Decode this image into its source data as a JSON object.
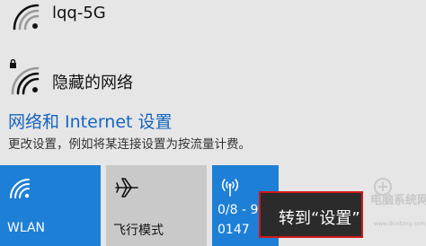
{
  "networks": [
    {
      "name": "lqq-5G",
      "icon": "wifi-icon"
    },
    {
      "name": "隐藏的网络",
      "icon": "wifi-lock-icon"
    }
  ],
  "settings": {
    "link_label": "网络和 Internet 设置",
    "description": "更改设置，例如将某连接设置为按流量计费。"
  },
  "tiles": {
    "wlan": {
      "label": "WLAN",
      "icon": "wifi-icon"
    },
    "airplane": {
      "label": "飞行模式",
      "icon": "airplane-icon"
    },
    "hotspot": {
      "line1": "0/8 - 9",
      "line2": "0147",
      "icon": "hotspot-icon"
    }
  },
  "tooltip": {
    "text": "转到“设置”"
  },
  "watermark": {
    "text": "电脑系统网",
    "url": "www.dnxitong.com"
  },
  "colors": {
    "accent": "#1e7fd6",
    "link": "#1565c0",
    "background": "#e6e6e6",
    "tile_inactive": "#c9c9c9",
    "tooltip_border": "#d01818"
  }
}
